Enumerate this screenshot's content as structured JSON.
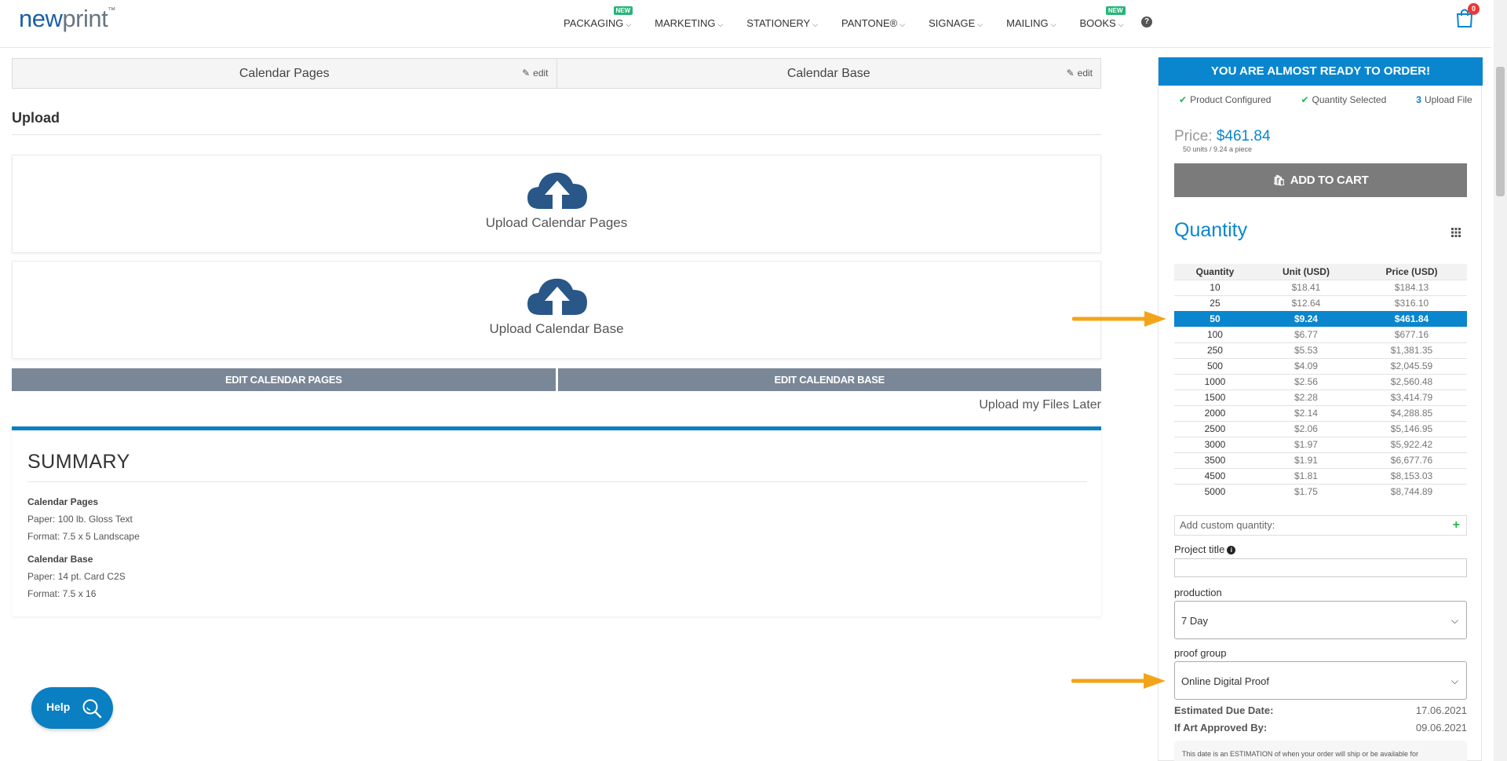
{
  "header": {
    "logo_new": "new",
    "logo_print": "print",
    "logo_tm": "™",
    "nav": [
      {
        "label": "PACKAGING",
        "badge": "NEW"
      },
      {
        "label": "MARKETING",
        "badge": ""
      },
      {
        "label": "STATIONERY",
        "badge": ""
      },
      {
        "label": "PANTONE®",
        "badge": ""
      },
      {
        "label": "SIGNAGE",
        "badge": ""
      },
      {
        "label": "MAILING",
        "badge": ""
      },
      {
        "label": "BOOKS",
        "badge": "NEW"
      }
    ],
    "help_glyph": "?",
    "cart_count": "0"
  },
  "tabs": [
    {
      "label": "Calendar Pages",
      "edit": "edit"
    },
    {
      "label": "Calendar Base",
      "edit": "edit"
    }
  ],
  "upload": {
    "title": "Upload",
    "pages_label": "Upload Calendar Pages",
    "base_label": "Upload Calendar Base",
    "edit_pages_btn": "EDIT CALENDAR PAGES",
    "edit_base_btn": "EDIT CALENDAR BASE",
    "later_link": "Upload my Files Later"
  },
  "summary": {
    "title": "SUMMARY",
    "pages_heading": "Calendar Pages",
    "pages_paper": "Paper: 100 lb. Gloss Text",
    "pages_format": "Format: 7.5 x 5 Landscape",
    "base_heading": "Calendar Base",
    "base_paper": "Paper: 14 pt. Card C2S",
    "base_format": "Format: 7.5 x 16"
  },
  "help_button": {
    "label": "Help"
  },
  "sidebar": {
    "header": "YOU ARE ALMOST READY TO ORDER!",
    "steps": [
      {
        "mark": "✔",
        "label": "Product Configured"
      },
      {
        "mark": "✔",
        "label": "Quantity Selected"
      },
      {
        "mark": "3",
        "label": "Upload File"
      }
    ],
    "price_label": "Price:",
    "price_value": "$461.84",
    "price_sub": "50 units / 9.24 a piece",
    "add_to_cart": "ADD TO CART",
    "quantity_title": "Quantity",
    "table": {
      "headers": [
        "Quantity",
        "Unit (USD)",
        "Price (USD)"
      ],
      "rows": [
        [
          "10",
          "$18.41",
          "$184.13"
        ],
        [
          "25",
          "$12.64",
          "$316.10"
        ],
        [
          "50",
          "$9.24",
          "$461.84"
        ],
        [
          "100",
          "$6.77",
          "$677.16"
        ],
        [
          "250",
          "$5.53",
          "$1,381.35"
        ],
        [
          "500",
          "$4.09",
          "$2,045.59"
        ],
        [
          "1000",
          "$2.56",
          "$2,560.48"
        ],
        [
          "1500",
          "$2.28",
          "$3,414.79"
        ],
        [
          "2000",
          "$2.14",
          "$4,288.85"
        ],
        [
          "2500",
          "$2.06",
          "$5,146.95"
        ],
        [
          "3000",
          "$1.97",
          "$5,922.42"
        ],
        [
          "3500",
          "$1.91",
          "$6,677.76"
        ],
        [
          "4500",
          "$1.81",
          "$8,153.03"
        ],
        [
          "5000",
          "$1.75",
          "$8,744.89"
        ]
      ],
      "selected_row": 2
    },
    "custom_placeholder": "Add custom quantity:",
    "project_title_label": "Project title",
    "production_label": "production",
    "production_value": "7 Day",
    "proof_label": "proof group",
    "proof_value": "Online Digital Proof",
    "due_label": "Estimated Due Date:",
    "due_value": "17.06.2021",
    "approved_label": "If Art Approved By:",
    "approved_value": "09.06.2021",
    "note": "This date is an ESTIMATION of when your order will ship or be available for"
  },
  "colors": {
    "accent": "#0a86ce",
    "arrow": "#f2a51a",
    "check": "#25b548"
  }
}
